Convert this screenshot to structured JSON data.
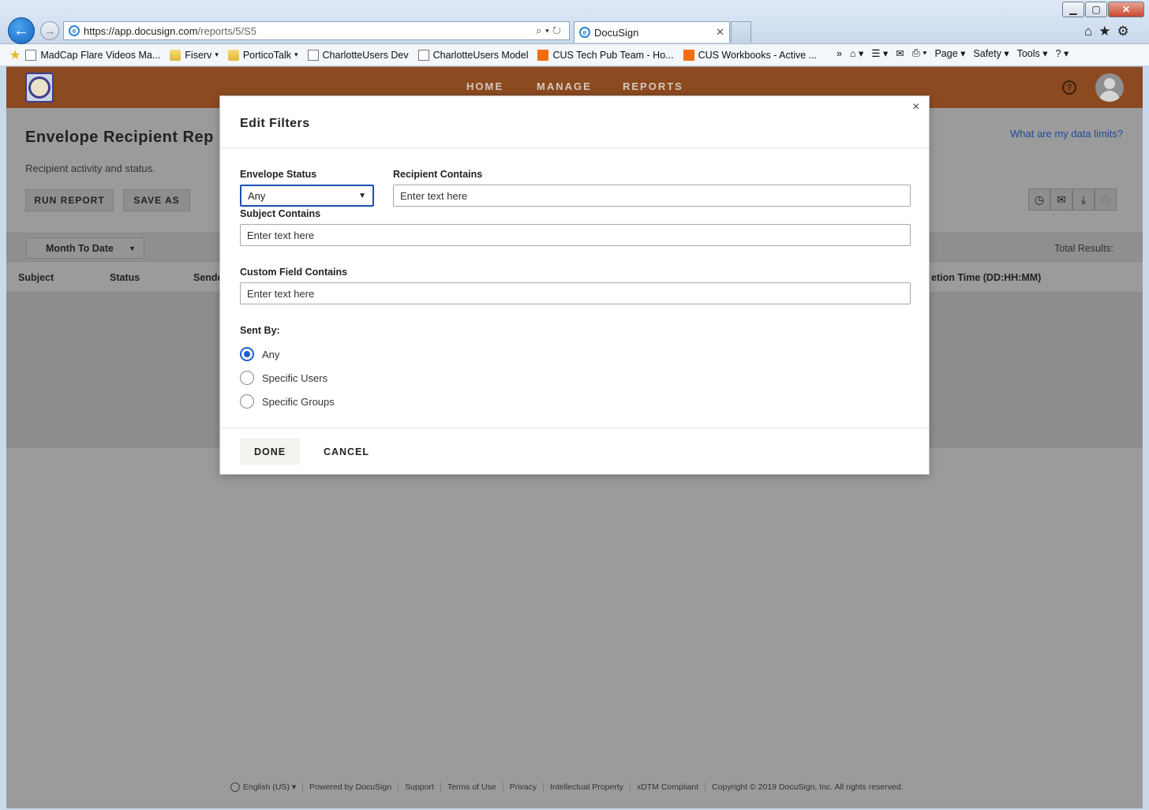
{
  "browser": {
    "url_host": "https://app.docusign.com",
    "url_path": "/reports/5/S5",
    "tab_title": "DocuSign",
    "favorites": [
      {
        "label": "MadCap Flare Videos  Ma...",
        "type": "page"
      },
      {
        "label": "Fiserv",
        "type": "folder",
        "caret": "▾"
      },
      {
        "label": "PorticoTalk",
        "type": "folder",
        "caret": "▾"
      },
      {
        "label": "CharlotteUsers Dev",
        "type": "page"
      },
      {
        "label": "CharlotteUsers Model",
        "type": "page"
      },
      {
        "label": "CUS Tech Pub Team - Ho...",
        "type": "orange"
      },
      {
        "label": "CUS Workbooks - Active ...",
        "type": "orange"
      }
    ],
    "command_bar": [
      "Page ▾",
      "Safety ▾",
      "Tools ▾"
    ]
  },
  "header": {
    "nav": [
      "HOME",
      "MANAGE",
      "REPORTS"
    ],
    "help": "?"
  },
  "report": {
    "title": "Envelope Recipient Rep",
    "subtitle": "Recipient activity and status.",
    "data_limits_link": "What are my data limits?",
    "run_report": "RUN REPORT",
    "save_as": "SAVE AS",
    "date_filter": "Month To Date",
    "total_results": "Total Results:",
    "columns": {
      "subject": "Subject",
      "status": "Status",
      "sender": "Sende",
      "time": "etion Time (DD:HH:MM)"
    }
  },
  "modal": {
    "title": "Edit Filters",
    "close": "×",
    "envelope_status_label": "Envelope Status",
    "envelope_status_value": "Any",
    "recipient_label": "Recipient Contains",
    "recipient_placeholder": "Enter text here",
    "subject_label": "Subject Contains",
    "subject_placeholder": "Enter text here",
    "custom_label": "Custom Field Contains",
    "custom_placeholder": "Enter text here",
    "sent_by_label": "Sent By:",
    "sent_by_options": [
      {
        "label": "Any",
        "checked": true
      },
      {
        "label": "Specific Users",
        "checked": false
      },
      {
        "label": "Specific Groups",
        "checked": false
      }
    ],
    "done": "DONE",
    "cancel": "CANCEL"
  },
  "footer": {
    "language": "English (US)",
    "links": [
      "Powered by DocuSign",
      "Support",
      "Terms of Use",
      "Privacy",
      "Intellectual Property",
      "xDTM Compliant",
      "Copyright © 2019 DocuSign, Inc. All rights reserved."
    ]
  },
  "colors": {
    "header_brand": "#8c4a21",
    "accent_blue": "#1a5fd6"
  }
}
